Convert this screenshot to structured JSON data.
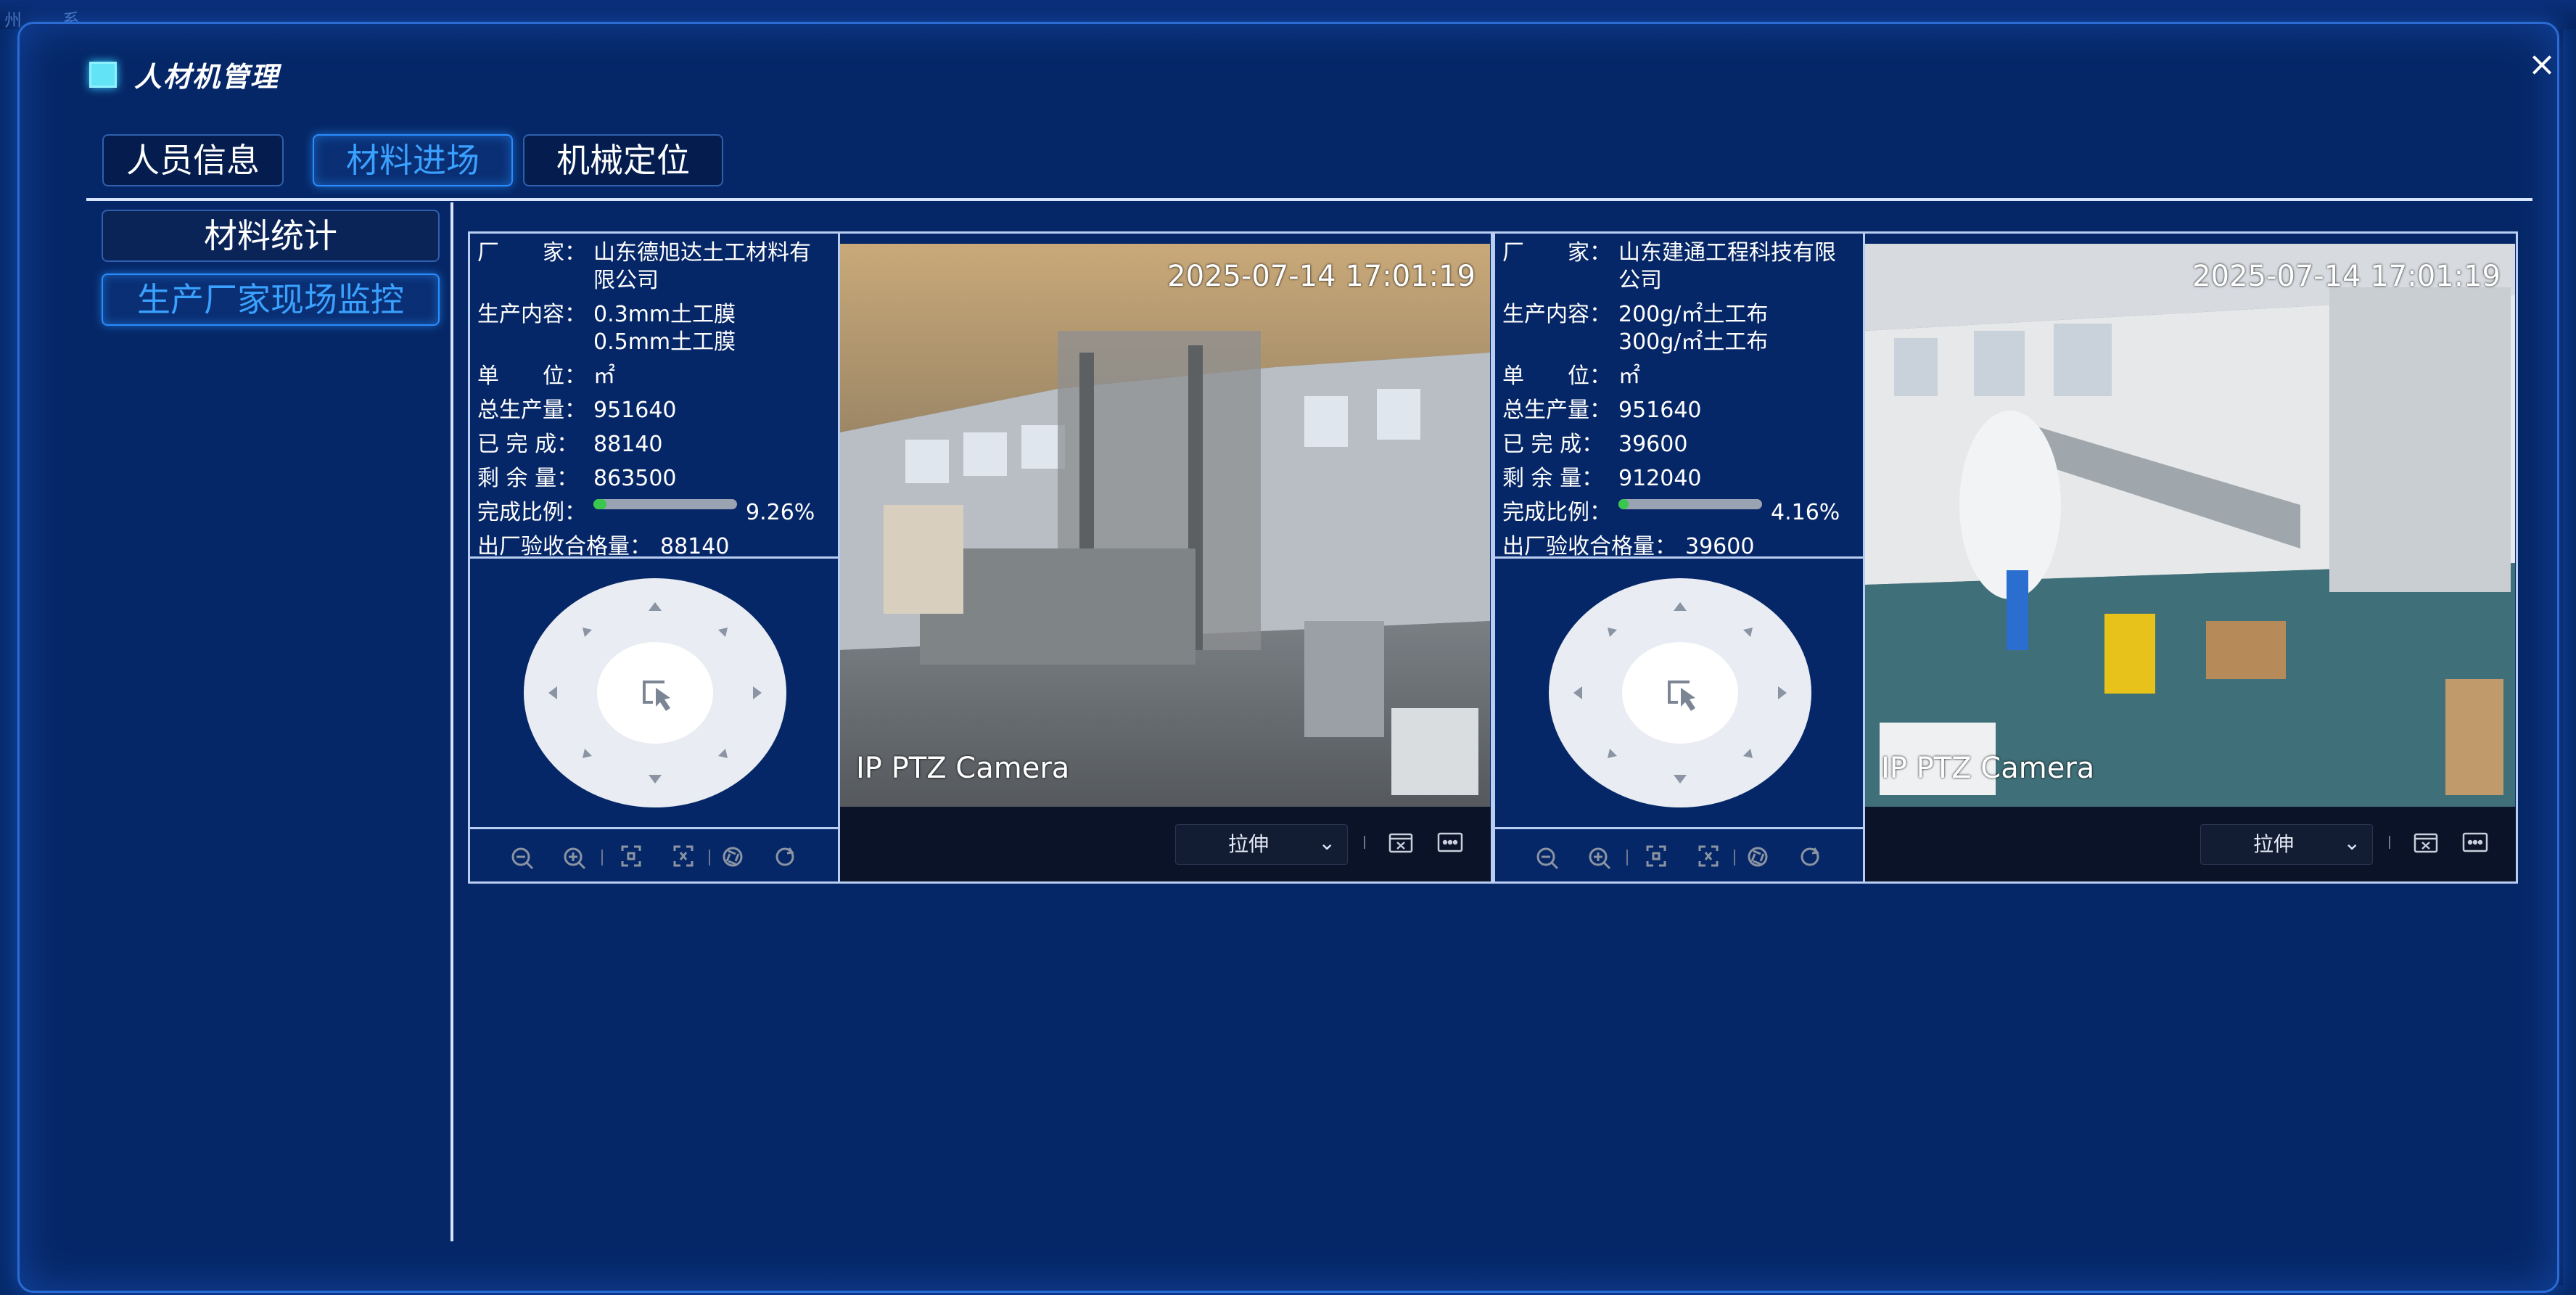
{
  "background": {
    "left_text": "州",
    "left_text2": "系"
  },
  "modal": {
    "title": "人材机管理",
    "close_label": "×"
  },
  "tabs": [
    {
      "label": "人员信息",
      "active": false
    },
    {
      "label": "材料进场",
      "active": true
    },
    {
      "label": "机械定位",
      "active": false
    }
  ],
  "sidebar": [
    {
      "label": "材料统计",
      "active": false
    },
    {
      "label": "生产厂家现场监控",
      "active": true
    }
  ],
  "field_labels": {
    "maker": "厂　　家：",
    "content": "生产内容：",
    "unit": "单　　位：",
    "total": "总生产量：",
    "done": "已 完 成：",
    "remaining": "剩 余 量：",
    "ratio": "完成比例：",
    "passed": "出厂验收合格量："
  },
  "cards": [
    {
      "maker_line1": "山东德旭达土工材料有",
      "maker_line2": "限公司",
      "content_line1": "0.3mm土工膜",
      "content_line2": "0.5mm土工膜",
      "unit": "㎡",
      "total": "951640",
      "done": "88140",
      "remaining": "863500",
      "ratio_text": "9.26%",
      "ratio_value": 0.0926,
      "passed": "88140",
      "timestamp": "2025-07-14 17:01:19",
      "camera_label": "IP PTZ Camera",
      "stretch_label": "拉伸"
    },
    {
      "maker_line1": "山东建通工程科技有限",
      "maker_line2": "公司",
      "content_line1": "200g/㎡土工布",
      "content_line2": "300g/㎡土工布",
      "unit": "㎡",
      "total": "951640",
      "done": "39600",
      "remaining": "912040",
      "ratio_text": "4.16%",
      "ratio_value": 0.0416,
      "passed": "39600",
      "timestamp": "2025-07-14 17:01:19",
      "camera_label": "IP PTZ Camera",
      "stretch_label": "拉伸"
    }
  ],
  "colors": {
    "accent": "#3aa1ff",
    "progress": "#39c84d",
    "panel": "#062767"
  },
  "icons": [
    "zoom-out-icon",
    "zoom-in-icon",
    "focus-near-icon",
    "focus-far-icon",
    "iris-icon",
    "refresh-icon",
    "screenshot-icon",
    "more-icon",
    "chevron-down-icon",
    "ptz-select-icon"
  ]
}
